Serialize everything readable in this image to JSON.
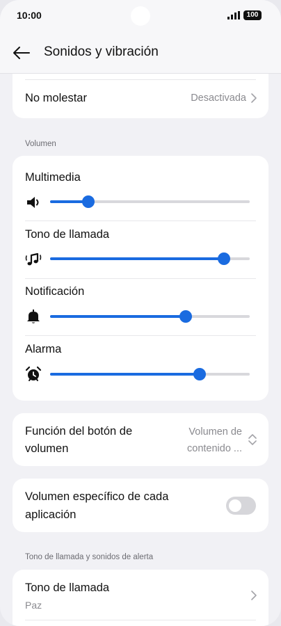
{
  "status_bar": {
    "time": "10:00",
    "battery": "100"
  },
  "header": {
    "title": "Sonidos y vibración"
  },
  "do_not_disturb": {
    "label": "No molestar",
    "value": "Desactivada"
  },
  "volume_section": {
    "label": "Volumen",
    "sliders": [
      {
        "label": "Multimedia",
        "icon": "speaker-icon",
        "level": 0.19
      },
      {
        "label": "Tono de llamada",
        "icon": "music-note-icon",
        "level": 0.87
      },
      {
        "label": "Notificación",
        "icon": "bell-icon",
        "level": 0.68
      },
      {
        "label": "Alarma",
        "icon": "alarm-clock-icon",
        "level": 0.75
      }
    ]
  },
  "volume_button": {
    "label_line1": "Función del botón de",
    "label_line2": "volumen",
    "value_line1": "Volumen de",
    "value_line2": "contenido ..."
  },
  "app_volume": {
    "label_line1": "Volumen específico de cada",
    "label_line2": "aplicación",
    "enabled": false
  },
  "ringtones_section": {
    "label": "Tono de llamada y sonidos de alerta"
  },
  "ringtone": {
    "label": "Tono de llamada",
    "value": "Paz"
  },
  "colors": {
    "accent": "#1a6be0",
    "track": "#d8d8dc",
    "background": "#f1f1f5",
    "card": "#ffffff"
  }
}
